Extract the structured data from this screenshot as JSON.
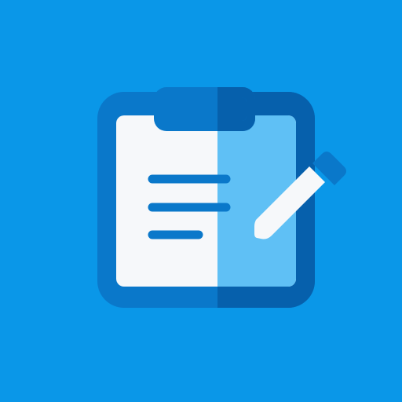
{
  "icon": {
    "name": "clipboard-edit-icon",
    "colors": {
      "background": "#0A97E8",
      "board_frame": "#0A78CA",
      "board_frame_shade": "#0660AC",
      "paper": "#F6F8FA",
      "paper_shade": "#5FC0F5",
      "text_lines": "#0A78CA",
      "pencil_tip": "#F6F8FA",
      "pencil_cap": "#0A78CA"
    },
    "text_line_count": 3
  }
}
